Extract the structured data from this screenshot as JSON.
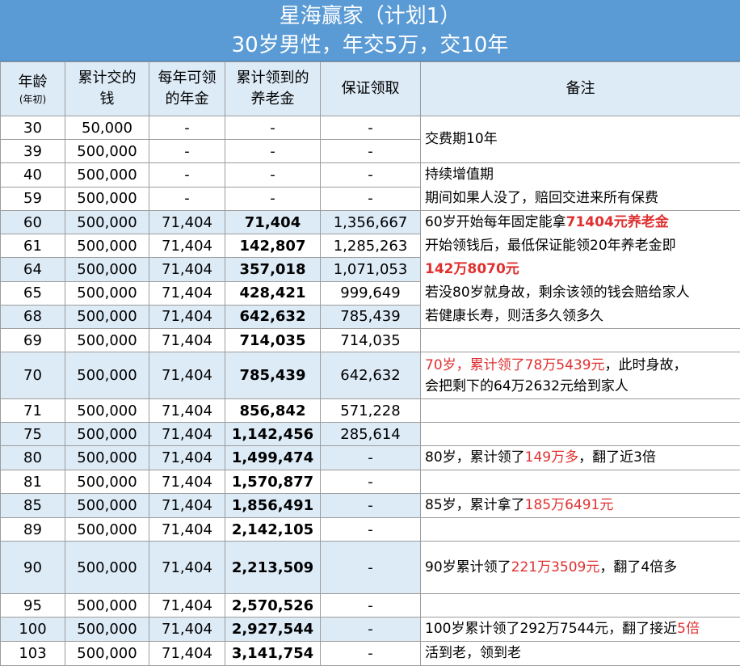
{
  "title": {
    "line1": "星海赢家（计划1）",
    "line2": "30岁男性，年交5万，交10年"
  },
  "headers": {
    "age": "年龄",
    "age_sub": "(年初)",
    "paid": "累计交的钱",
    "annuity": "每年可领的年金",
    "cumulative": "累计领到的养老金",
    "guaranteed": "保证领取",
    "notes": "备注"
  },
  "rows": [
    {
      "age": "30",
      "paid": "50,000",
      "annuity": "-",
      "cumulative": "-",
      "guaranteed": "-"
    },
    {
      "age": "39",
      "paid": "500,000",
      "annuity": "-",
      "cumulative": "-",
      "guaranteed": "-"
    },
    {
      "age": "40",
      "paid": "500,000",
      "annuity": "-",
      "cumulative": "-",
      "guaranteed": "-"
    },
    {
      "age": "59",
      "paid": "500,000",
      "annuity": "-",
      "cumulative": "-",
      "guaranteed": "-"
    },
    {
      "age": "60",
      "paid": "500,000",
      "annuity": "71,404",
      "cumulative": "71,404",
      "guaranteed": "1,356,667"
    },
    {
      "age": "61",
      "paid": "500,000",
      "annuity": "71,404",
      "cumulative": "142,807",
      "guaranteed": "1,285,263"
    },
    {
      "age": "64",
      "paid": "500,000",
      "annuity": "71,404",
      "cumulative": "357,018",
      "guaranteed": "1,071,053"
    },
    {
      "age": "65",
      "paid": "500,000",
      "annuity": "71,404",
      "cumulative": "428,421",
      "guaranteed": "999,649"
    },
    {
      "age": "68",
      "paid": "500,000",
      "annuity": "71,404",
      "cumulative": "642,632",
      "guaranteed": "785,439"
    },
    {
      "age": "69",
      "paid": "500,000",
      "annuity": "71,404",
      "cumulative": "714,035",
      "guaranteed": "714,035"
    },
    {
      "age": "70",
      "paid": "500,000",
      "annuity": "71,404",
      "cumulative": "785,439",
      "guaranteed": "642,632"
    },
    {
      "age": "71",
      "paid": "500,000",
      "annuity": "71,404",
      "cumulative": "856,842",
      "guaranteed": "571,228"
    },
    {
      "age": "75",
      "paid": "500,000",
      "annuity": "71,404",
      "cumulative": "1,142,456",
      "guaranteed": "285,614"
    },
    {
      "age": "80",
      "paid": "500,000",
      "annuity": "71,404",
      "cumulative": "1,499,474",
      "guaranteed": "-"
    },
    {
      "age": "81",
      "paid": "500,000",
      "annuity": "71,404",
      "cumulative": "1,570,877",
      "guaranteed": "-"
    },
    {
      "age": "85",
      "paid": "500,000",
      "annuity": "71,404",
      "cumulative": "1,856,491",
      "guaranteed": "-"
    },
    {
      "age": "89",
      "paid": "500,000",
      "annuity": "71,404",
      "cumulative": "2,142,105",
      "guaranteed": "-"
    },
    {
      "age": "90",
      "paid": "500,000",
      "annuity": "71,404",
      "cumulative": "2,213,509",
      "guaranteed": "-"
    },
    {
      "age": "95",
      "paid": "500,000",
      "annuity": "71,404",
      "cumulative": "2,570,526",
      "guaranteed": "-"
    },
    {
      "age": "100",
      "paid": "500,000",
      "annuity": "71,404",
      "cumulative": "2,927,544",
      "guaranteed": "-"
    },
    {
      "age": "103",
      "paid": "500,000",
      "annuity": "71,404",
      "cumulative": "3,141,754",
      "guaranteed": "-"
    }
  ],
  "notes": {
    "n1": "交费期10年",
    "n2a": "持续增值期",
    "n2b": "期间如果人没了，赔回交进来所有保费",
    "n3a_pre": "60岁开始每年固定能拿",
    "n3a_hl": "71404元养老金",
    "n3b": "开始领钱后，最低保证能领20年养老金即",
    "n3c_hl": "142万8070元",
    "n3d": "若没80岁就身故，剩余该领的钱会赔给家人",
    "n3e": "若健康长寿，则活多久领多久",
    "n70a_hl": "70岁，累计领了78万5439元",
    "n70a_post": "，此时身故，",
    "n70b": "会把剩下的64万2632元给到家人",
    "n80_pre": "80岁，累计领了",
    "n80_hl": "149万多",
    "n80_post": "，翻了近3倍",
    "n85_pre": "85岁，累计拿了",
    "n85_hl": "185万6491元",
    "n90_pre": "90岁累计领了",
    "n90_hl": "221万3509元",
    "n90_post": "，翻了4倍多",
    "n100_pre": "100岁累计领了292万7544元，翻了接近",
    "n100_hl": "5倍",
    "n103": "活到老，领到老"
  },
  "colors": {
    "title_bg": "#5b9bd5",
    "header_bg": "#ddebf7",
    "highlight_red": "#e03030"
  }
}
